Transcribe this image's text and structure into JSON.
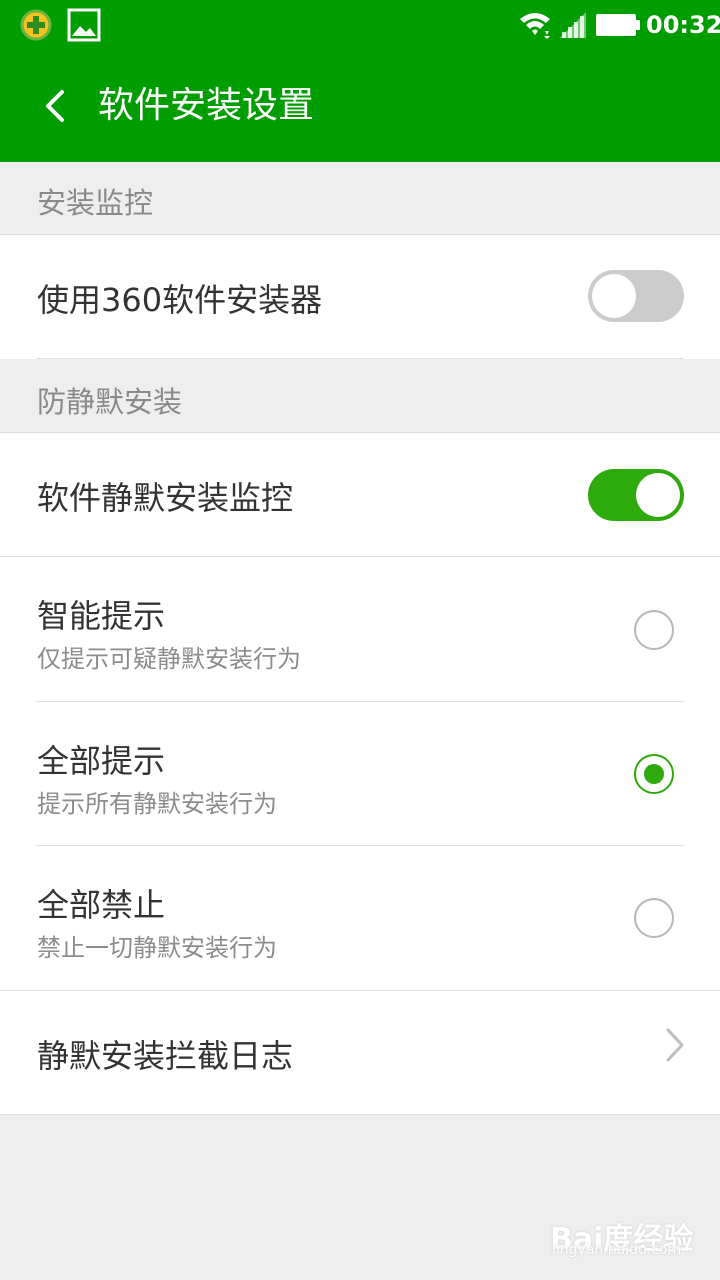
{
  "status_bar": {
    "time": "00:32",
    "icons": [
      "app-360-icon",
      "gallery-icon",
      "wifi-icon",
      "signal-icon",
      "battery-icon"
    ]
  },
  "header": {
    "title": "软件安装设置",
    "background": "#009d00"
  },
  "sections": {
    "install_monitor": {
      "header": "安装监控",
      "item_label": "使用360软件安装器",
      "toggle_on": false
    },
    "silent_install": {
      "header": "防静默安装",
      "monitor_label": "软件静默安装监控",
      "monitor_toggle_on": true,
      "options": [
        {
          "title": "智能提示",
          "subtitle": "仅提示可疑静默安装行为",
          "selected": false
        },
        {
          "title": "全部提示",
          "subtitle": "提示所有静默安装行为",
          "selected": true
        },
        {
          "title": "全部禁止",
          "subtitle": "禁止一切静默安装行为",
          "selected": false
        }
      ],
      "log_label": "静默安装拦截日志"
    }
  },
  "colors": {
    "accent": "#2eaa0c",
    "toggle_off": "#cccccc"
  },
  "watermark": {
    "main": "Bai度经验",
    "sub": "jingyan.baidu.com"
  }
}
